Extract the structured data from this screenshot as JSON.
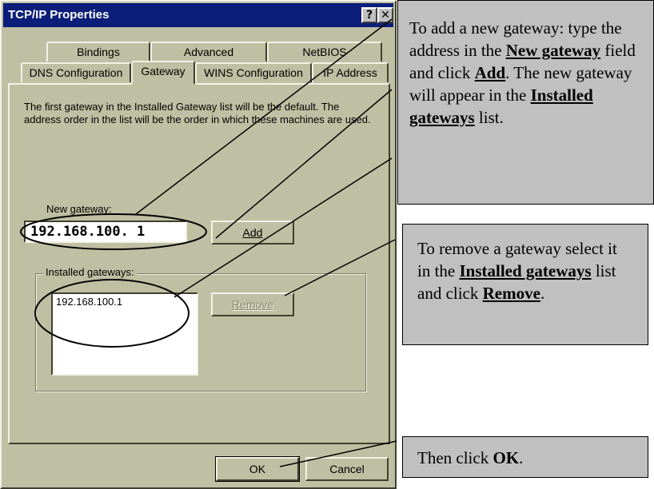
{
  "dialog": {
    "title": "TCP/IP Properties",
    "help_glyph": "?",
    "close_glyph": "✕",
    "tabs_back": [
      "Bindings",
      "Advanced",
      "NetBIOS"
    ],
    "tabs_front": [
      "DNS Configuration",
      "Gateway",
      "WINS Configuration",
      "IP Address"
    ],
    "selected_tab": "Gateway",
    "description": "The first gateway in the Installed Gateway list will be the default. The address order in the list will be the order in which these machines are used.",
    "new_gateway_label": "New gateway:",
    "new_gateway_value": "192.168.100. 1",
    "add_button": "Add",
    "installed_label": "Installed gateways:",
    "installed_items": [
      "192.168.100.1"
    ],
    "remove_button": "Remove",
    "ok_button": "OK",
    "cancel_button": "Cancel"
  },
  "callouts": {
    "add": {
      "t1": "To add a new gateway: type the address in the",
      "b1": "New gateway",
      "t2": "field and click",
      "b2": "Add",
      "t3": ". The new gateway will appear in the",
      "b3": "Installed gateways",
      "t4": "list."
    },
    "remove": {
      "t1": "To remove a gateway select it in the",
      "b1": "Installed gateways",
      "t2": "list and click",
      "b2": "Remove",
      "t3": "."
    },
    "ok": {
      "t1": "Then click",
      "b1": "OK",
      "t2": "."
    }
  },
  "colors": {
    "dialog_face": "#bfbfa3",
    "titlebar": "#0a1e7a",
    "callout_bg": "#c0c0c0"
  }
}
